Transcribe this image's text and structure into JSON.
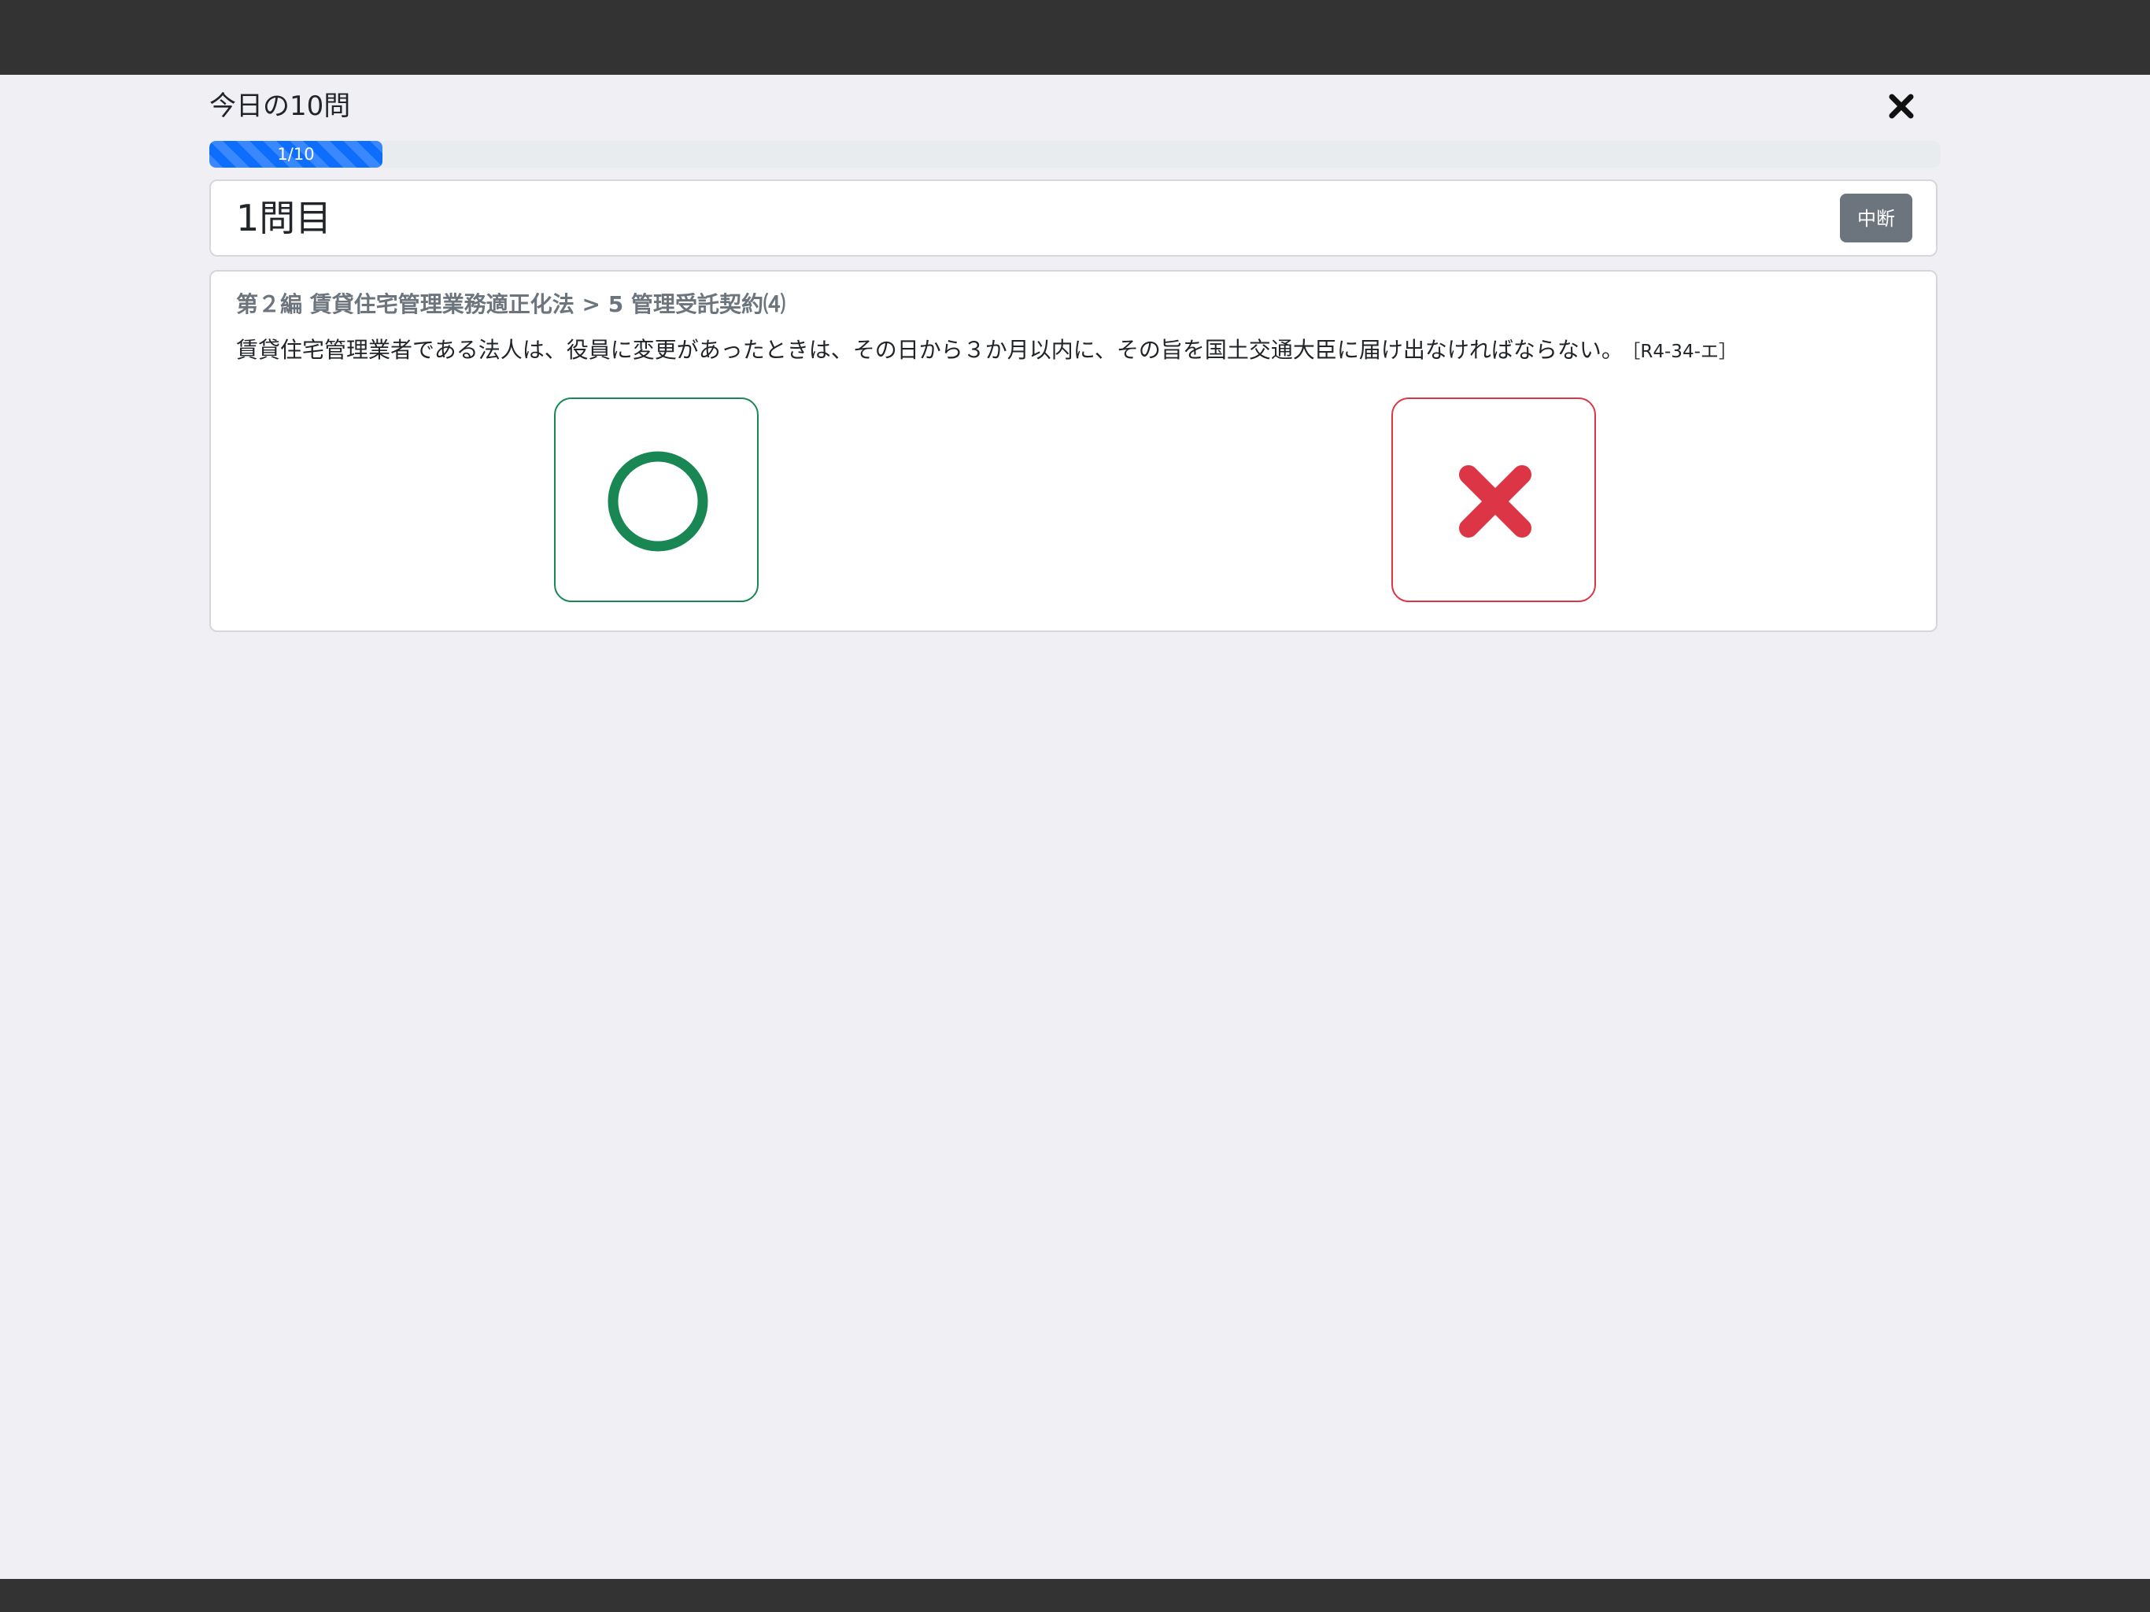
{
  "session": {
    "title": "今日の10問",
    "close_icon": "close-icon"
  },
  "progress": {
    "label": "1/10",
    "current": 1,
    "total": 10,
    "color": "#0d6efd"
  },
  "question_header": {
    "number_label": "1問目",
    "pause_label": "中断"
  },
  "question": {
    "category": "第２編 賃貸住宅管理業務適正化法 > 5 管理受託契約⑷",
    "text": "賃貸住宅管理業者である法人は、役員に変更があったときは、その日から３か月以内に、その旨を国土交通大臣に届け出なければならない。",
    "source": "［R4-34-エ］"
  },
  "answers": {
    "true_icon": "circle-icon",
    "false_icon": "cross-icon",
    "true_color": "#198754",
    "false_color": "#dc3545"
  }
}
